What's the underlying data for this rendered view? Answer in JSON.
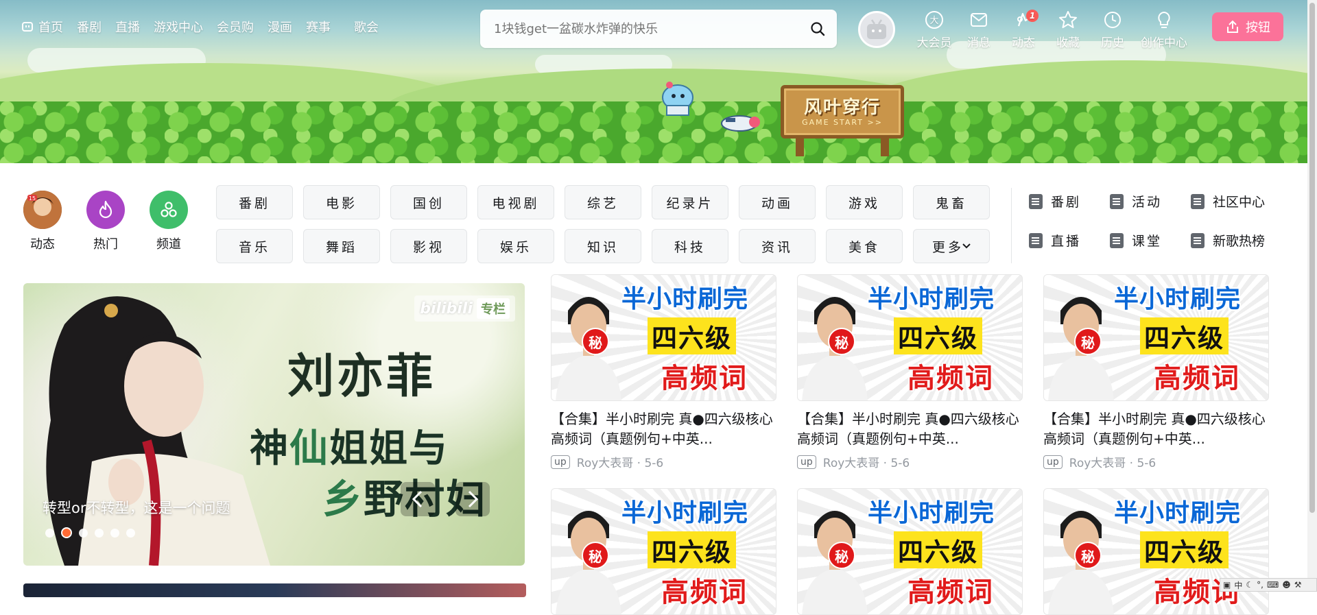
{
  "nav": {
    "left_items": [
      {
        "label": "首页",
        "icon": "bilibili-tv-icon"
      },
      {
        "label": "番剧"
      },
      {
        "label": "直播"
      },
      {
        "label": "游戏中心"
      },
      {
        "label": "会员购"
      },
      {
        "label": "漫画"
      },
      {
        "label": "赛事"
      },
      {
        "label": "歌会"
      }
    ],
    "search_placeholder": "1块钱get一盆碳水炸弹的快乐",
    "right_items": [
      {
        "label": "大会员",
        "icon": "vip-icon"
      },
      {
        "label": "消息",
        "icon": "message-icon"
      },
      {
        "label": "动态",
        "icon": "dynamic-icon",
        "badge": "1"
      },
      {
        "label": "收藏",
        "icon": "star-icon"
      },
      {
        "label": "历史",
        "icon": "clock-icon"
      },
      {
        "label": "创作中心",
        "icon": "bulb-icon"
      }
    ],
    "upload_label": "按钮"
  },
  "banner": {
    "sign_title": "风叶穿行",
    "sign_sub": "GAME START >>"
  },
  "quick": [
    {
      "label": "动态",
      "color": "#7a4a2c"
    },
    {
      "label": "热门",
      "color": "#a944c5"
    },
    {
      "label": "频道",
      "color": "#3fbe6a"
    }
  ],
  "categories": [
    "番剧",
    "电影",
    "国创",
    "电视剧",
    "综艺",
    "纪录片",
    "动画",
    "游戏",
    "鬼畜",
    "音乐",
    "舞蹈",
    "影视",
    "娱乐",
    "知识",
    "科技",
    "资讯",
    "美食",
    "更多"
  ],
  "side_links": [
    "番剧",
    "活动",
    "社区中心",
    "直播",
    "课堂",
    "新歌热榜"
  ],
  "carousel": {
    "brand_logo": "bilibili",
    "brand_tag": "专栏",
    "headline1": "刘亦菲",
    "headline2a": "神",
    "headline2b": "仙",
    "headline2c": "姐姐与",
    "headline3a": "乡",
    "headline3b": "野村妇",
    "caption": "转型or不转型，这是一个问题",
    "dots": 6,
    "active_dot": 1
  },
  "cards": [
    {
      "t1": "半小时刷完",
      "t2": "四六级",
      "t3": "高频词",
      "seal": "秘",
      "title": "【合集】半小时刷完 真●四六级核心高频词（真题例句+中英...",
      "up_tag": "up",
      "meta": "Roy大表哥 · 5-6"
    },
    {
      "t1": "半小时刷完",
      "t2": "四六级",
      "t3": "高频词",
      "seal": "秘",
      "title": "【合集】半小时刷完 真●四六级核心高频词（真题例句+中英...",
      "up_tag": "up",
      "meta": "Roy大表哥 · 5-6"
    },
    {
      "t1": "半小时刷完",
      "t2": "四六级",
      "t3": "高频词",
      "seal": "秘",
      "title": "【合集】半小时刷完 真●四六级核心高频词（真题例句+中英...",
      "up_tag": "up",
      "meta": "Roy大表哥 · 5-6"
    },
    {
      "t1": "半小时刷完",
      "t2": "四六级",
      "t3": "高频词",
      "seal": "秘",
      "title": "",
      "up_tag": "",
      "meta": ""
    },
    {
      "t1": "半小时刷完",
      "t2": "四六级",
      "t3": "高频词",
      "seal": "秘",
      "title": "",
      "up_tag": "",
      "meta": ""
    },
    {
      "t1": "半小时刷完",
      "t2": "四六级",
      "t3": "高频词",
      "seal": "秘",
      "title": "",
      "up_tag": "",
      "meta": ""
    }
  ],
  "tray": {
    "ime": "中"
  },
  "colors": {
    "accent_pink": "#fb7299",
    "badge_red": "#fa5a57",
    "active_dot": "#ff6b35"
  }
}
